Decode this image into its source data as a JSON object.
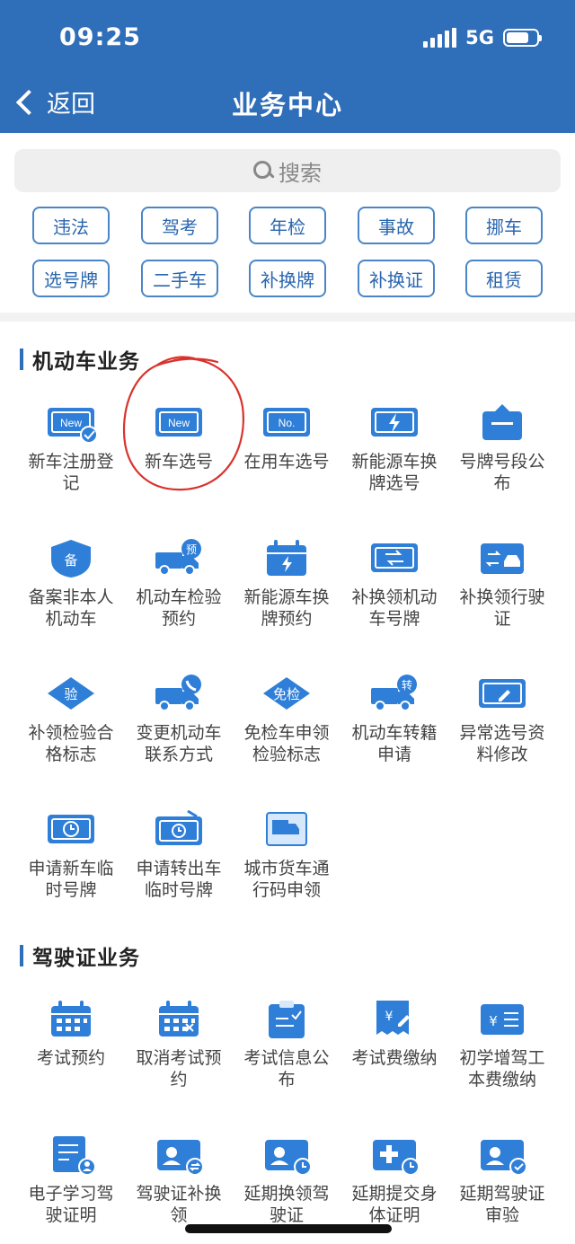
{
  "status": {
    "time": "09:25",
    "network": "5G"
  },
  "nav": {
    "back_label": "返回",
    "title": "业务中心"
  },
  "search": {
    "placeholder": "搜索"
  },
  "quick_tags": [
    "违法",
    "驾考",
    "年检",
    "事故",
    "挪车",
    "选号牌",
    "二手车",
    "补换牌",
    "补换证",
    "租赁"
  ],
  "sections": [
    {
      "title": "机动车业务",
      "items": [
        {
          "label": "新车注册登记",
          "icon": "new-plate-check-icon"
        },
        {
          "label": "新车选号",
          "icon": "new-plate-icon"
        },
        {
          "label": "在用车选号",
          "icon": "no-plate-icon"
        },
        {
          "label": "新能源车换牌选号",
          "icon": "energy-plate-icon"
        },
        {
          "label": "号牌号段公布",
          "icon": "sign-board-icon"
        },
        {
          "label": "备案非本人机动车",
          "icon": "shield-record-icon"
        },
        {
          "label": "机动车检验预约",
          "icon": "truck-appoint-icon"
        },
        {
          "label": "新能源车换牌预约",
          "icon": "calendar-bolt-icon"
        },
        {
          "label": "补换领机动车号牌",
          "icon": "plate-swap-icon"
        },
        {
          "label": "补换领行驶证",
          "icon": "car-swap-icon"
        },
        {
          "label": "补领检验合格标志",
          "icon": "inspect-diamond-icon"
        },
        {
          "label": "变更机动车联系方式",
          "icon": "truck-phone-icon"
        },
        {
          "label": "免检车申领检验标志",
          "icon": "exempt-diamond-icon"
        },
        {
          "label": "机动车转籍申请",
          "icon": "truck-transfer-icon"
        },
        {
          "label": "异常选号资料修改",
          "icon": "plate-edit-icon"
        },
        {
          "label": "申请新车临时号牌",
          "icon": "temp-plate-clock-icon"
        },
        {
          "label": "申请转出车临时号牌",
          "icon": "temp-plate-out-icon"
        },
        {
          "label": "城市货车通行码申领",
          "icon": "truck-pass-icon"
        }
      ]
    },
    {
      "title": "驾驶证业务",
      "items": [
        {
          "label": "考试预约",
          "icon": "calendar-grid-icon"
        },
        {
          "label": "取消考试预约",
          "icon": "calendar-cancel-icon"
        },
        {
          "label": "考试信息公布",
          "icon": "clipboard-icon"
        },
        {
          "label": "考试费缴纳",
          "icon": "fee-receipt-icon"
        },
        {
          "label": "初学增驾工本费缴纳",
          "icon": "fee-card-icon"
        },
        {
          "label": "电子学习驾驶证明",
          "icon": "doc-person-icon"
        },
        {
          "label": "驾驶证补换领",
          "icon": "license-swap-icon"
        },
        {
          "label": "延期换领驾驶证",
          "icon": "license-clock-icon"
        },
        {
          "label": "延期提交身体证明",
          "icon": "medical-clock-icon"
        },
        {
          "label": "延期驾驶证审验",
          "icon": "license-check-icon"
        }
      ]
    }
  ],
  "colors": {
    "header": "#2f6eb8",
    "icon_blue": "#2f7fd8",
    "icon_light": "#d7e8fb",
    "tag_border": "#4a86c7",
    "annotation": "#d9322c"
  }
}
